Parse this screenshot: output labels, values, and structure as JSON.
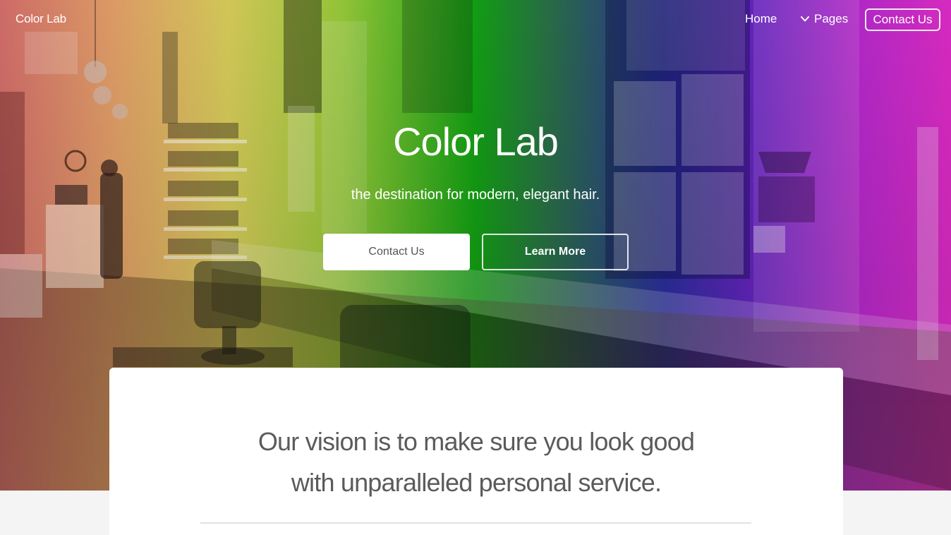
{
  "nav": {
    "brand": "Color Lab",
    "home": "Home",
    "pages": "Pages",
    "contact": "Contact Us"
  },
  "hero": {
    "title": "Color Lab",
    "subtitle": "the destination for modern, elegant hair.",
    "primary_button": "Contact Us",
    "secondary_button": "Learn More"
  },
  "vision": {
    "line1": "Our vision is to make sure you look good",
    "line2": "with unparalleled personal service."
  },
  "colors": {
    "hero_gradient": [
      "#d8706d",
      "#e7a36a",
      "#dcd05c",
      "#9acd3a",
      "#13a414",
      "#2c2fa2",
      "#6e24c7",
      "#e12cc9"
    ],
    "card_bg": "#ffffff",
    "page_bg": "#f4f4f4",
    "vision_text": "#5b5b5b"
  },
  "icons": {
    "pages_dropdown": "chevron-down-icon"
  }
}
